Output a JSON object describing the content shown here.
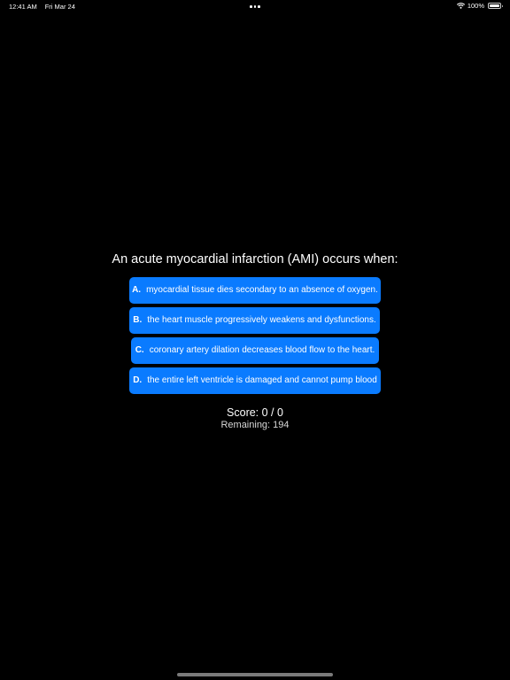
{
  "status_bar": {
    "time": "12:41 AM",
    "date": "Fri Mar 24",
    "battery": "100%",
    "wifi_icon": "wifi-icon",
    "battery_icon": "battery-full-icon",
    "multitask_icon": "three-dots-icon"
  },
  "quiz": {
    "question": "An acute myocardial infarction (AMI) occurs when:",
    "answers": [
      {
        "letter": "A.",
        "text": "myocardial tissue dies secondary to an absence of oxygen."
      },
      {
        "letter": "B.",
        "text": "the heart muscle progressively weakens and dysfunctions."
      },
      {
        "letter": "C.",
        "text": "coronary artery dilation decreases blood flow to the heart."
      },
      {
        "letter": "D.",
        "text": "the entire left ventricle is damaged and cannot pump blood"
      }
    ],
    "score": "Score: 0 / 0",
    "remaining": "Remaining: 194"
  },
  "colors": {
    "background": "#000000",
    "button": "#0a7bff",
    "text": "#ffffff"
  }
}
